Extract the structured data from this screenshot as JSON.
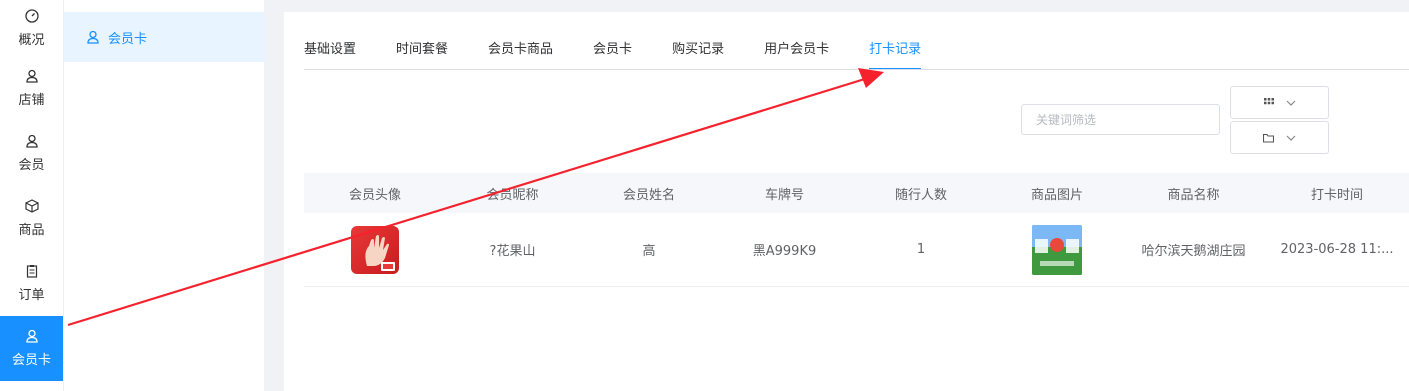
{
  "sidebar": {
    "items": [
      {
        "label": "概况",
        "icon": "dashboard-icon"
      },
      {
        "label": "店铺",
        "icon": "user-icon"
      },
      {
        "label": "会员",
        "icon": "user-icon"
      },
      {
        "label": "商品",
        "icon": "box-icon"
      },
      {
        "label": "订单",
        "icon": "clipboard-icon"
      },
      {
        "label": "会员卡",
        "icon": "user-icon",
        "active": true
      }
    ]
  },
  "submenu": {
    "items": [
      {
        "label": "会员卡",
        "icon": "user-icon",
        "active": true
      }
    ]
  },
  "tabs": [
    {
      "label": "基础设置"
    },
    {
      "label": "时间套餐"
    },
    {
      "label": "会员卡商品"
    },
    {
      "label": "会员卡"
    },
    {
      "label": "购买记录"
    },
    {
      "label": "用户会员卡"
    },
    {
      "label": "打卡记录",
      "active": true
    }
  ],
  "filter": {
    "placeholder": "关键词筛选"
  },
  "toolbar": {
    "grid_button_icon": "grid-icon",
    "folder_button_icon": "folder-icon"
  },
  "table": {
    "headers": [
      "会员头像",
      "会员昵称",
      "会员姓名",
      "车牌号",
      "随行人数",
      "商品图片",
      "商品名称",
      "打卡时间"
    ],
    "rows": [
      {
        "nickname": "?花果山",
        "name": "高",
        "plate": "黑A999K9",
        "companions": "1",
        "product_name": "哈尔滨天鹅湖庄园",
        "checkin_time": "2023-06-28 11:..."
      }
    ]
  },
  "colors": {
    "accent": "#1890ff",
    "annotation": "#f5222d"
  }
}
